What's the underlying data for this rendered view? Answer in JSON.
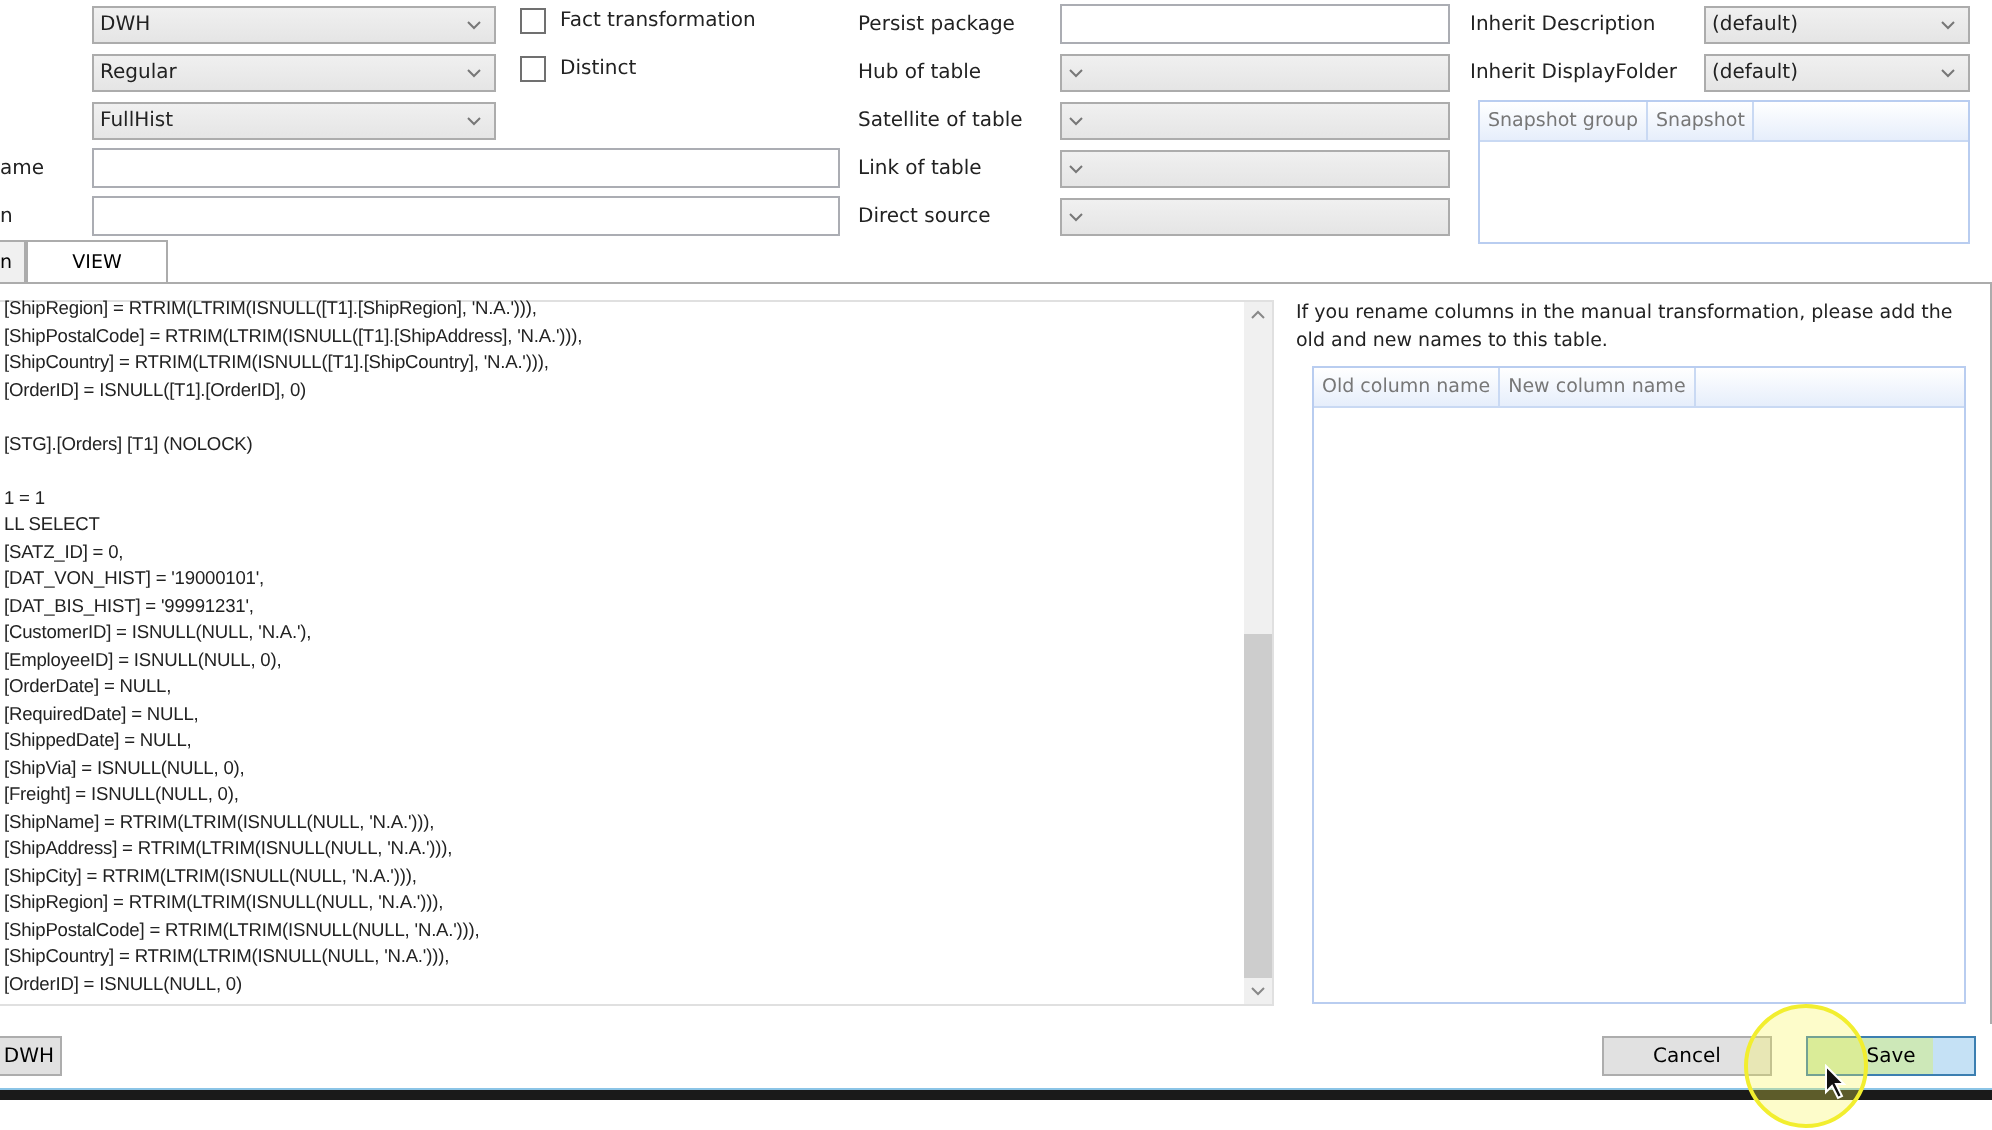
{
  "form": {
    "selects": [
      {
        "value": "DWH"
      },
      {
        "value": "Regular"
      },
      {
        "value": "FullHist"
      }
    ],
    "text_inputs": [
      {
        "label": "ame"
      },
      {
        "label": "n"
      }
    ],
    "checkboxes": [
      {
        "label": "Fact transformation",
        "checked": false
      },
      {
        "label": "Distinct",
        "checked": false
      }
    ],
    "table_fields": [
      {
        "label": "Persist package",
        "kind": "input"
      },
      {
        "label": "Hub of table",
        "kind": "select"
      },
      {
        "label": "Satellite of table",
        "kind": "select"
      },
      {
        "label": "Link of table",
        "kind": "select"
      },
      {
        "label": "Direct source",
        "kind": "select"
      }
    ],
    "inherit_fields": [
      {
        "label": "Inherit Description",
        "value": "(default)"
      },
      {
        "label": "Inherit DisplayFolder",
        "value": "(default)"
      }
    ],
    "snapshot_grid": {
      "columns": [
        "Snapshot group",
        "Snapshot"
      ]
    }
  },
  "tabs": [
    {
      "label": "n",
      "selected": false
    },
    {
      "label": "VIEW",
      "selected": true
    }
  ],
  "code_lines": [
    "[ShipRegion] = RTRIM(LTRIM(ISNULL([T1].[ShipRegion], 'N.A.'))),",
    "[ShipPostalCode] = RTRIM(LTRIM(ISNULL([T1].[ShipAddress], 'N.A.'))),",
    "[ShipCountry] = RTRIM(LTRIM(ISNULL([T1].[ShipCountry], 'N.A.'))),",
    "[OrderID] = ISNULL([T1].[OrderID], 0)",
    "[STG].[Orders] [T1] (NOLOCK)",
    "1 = 1",
    "LL SELECT",
    "[SATZ_ID] = 0,",
    "[DAT_VON_HIST] = '19000101',",
    "[DAT_BIS_HIST] = '99991231',",
    "[CustomerID] = ISNULL(NULL, 'N.A.'),",
    "[EmployeeID] = ISNULL(NULL, 0),",
    "[OrderDate] = NULL,",
    "[RequiredDate] = NULL,",
    "[ShippedDate] = NULL,",
    "[ShipVia] = ISNULL(NULL, 0),",
    "[Freight] = ISNULL(NULL, 0),",
    "[ShipName] = RTRIM(LTRIM(ISNULL(NULL, 'N.A.'))),",
    "[ShipAddress] = RTRIM(LTRIM(ISNULL(NULL, 'N.A.'))),",
    "[ShipCity] = RTRIM(LTRIM(ISNULL(NULL, 'N.A.'))),",
    "[ShipRegion] = RTRIM(LTRIM(ISNULL(NULL, 'N.A.'))),",
    "[ShipPostalCode] = RTRIM(LTRIM(ISNULL(NULL, 'N.A.'))),",
    "[ShipCountry] = RTRIM(LTRIM(ISNULL(NULL, 'N.A.'))),",
    "[OrderID] = ISNULL(NULL, 0)"
  ],
  "rename_panel": {
    "note": "If you rename columns in the manual transformation, please add the old and new names to this table.",
    "columns": [
      "Old column name",
      "New column name"
    ]
  },
  "footer": {
    "left_buttons": [
      {
        "label": "DWH",
        "hovered": false
      }
    ],
    "right_buttons": [
      {
        "label": "Cancel",
        "hovered": false
      },
      {
        "label": "Save",
        "hovered": true
      }
    ]
  }
}
